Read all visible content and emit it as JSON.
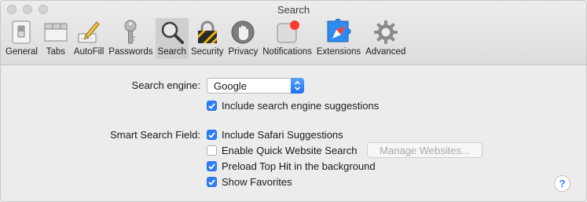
{
  "window": {
    "title": "Search"
  },
  "toolbar": {
    "items": [
      {
        "label": "General",
        "icon": "general-switch-icon"
      },
      {
        "label": "Tabs",
        "icon": "tabs-icon"
      },
      {
        "label": "AutoFill",
        "icon": "pencil-form-icon"
      },
      {
        "label": "Passwords",
        "icon": "key-icon"
      },
      {
        "label": "Search",
        "icon": "magnifier-icon",
        "selected": true
      },
      {
        "label": "Security",
        "icon": "lock-icon"
      },
      {
        "label": "Privacy",
        "icon": "hand-icon"
      },
      {
        "label": "Notifications",
        "icon": "notification-badge-icon"
      },
      {
        "label": "Extensions",
        "icon": "compass-puzzle-icon"
      },
      {
        "label": "Advanced",
        "icon": "gear-icon"
      }
    ]
  },
  "search_engine": {
    "label": "Search engine:",
    "value": "Google",
    "include_suggestions": {
      "label": "Include search engine suggestions",
      "checked": true
    }
  },
  "smart_search": {
    "label": "Smart Search Field:",
    "options": [
      {
        "label": "Include Safari Suggestions",
        "checked": true
      },
      {
        "label": "Enable Quick Website Search",
        "checked": false
      },
      {
        "label": "Preload Top Hit in the background",
        "checked": true
      },
      {
        "label": "Show Favorites",
        "checked": true
      }
    ],
    "manage_button": "Manage Websites..."
  },
  "help": {
    "label": "?"
  },
  "colors": {
    "accent": "#2f7cf6",
    "notification_badge": "#ff3b30"
  }
}
